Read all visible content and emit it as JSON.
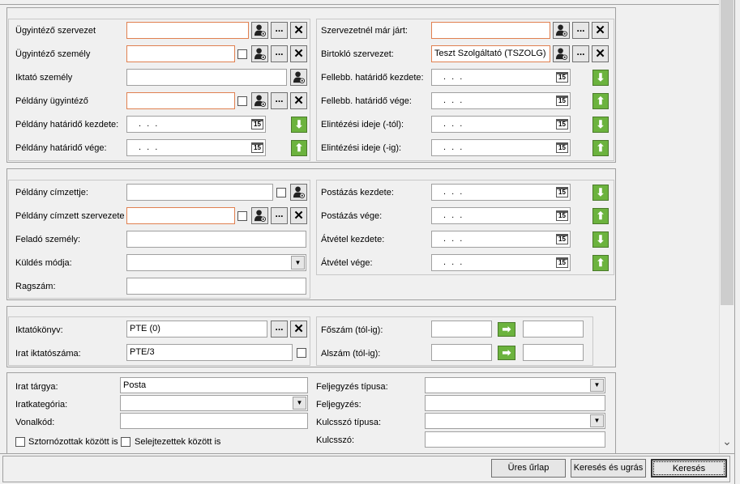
{
  "panel1": {
    "left": {
      "r1": {
        "label": "Ügyintéző szervezet",
        "value": ""
      },
      "r2": {
        "label": "Ügyintéző személy",
        "value": ""
      },
      "r3": {
        "label": "Iktató személy",
        "value": ""
      },
      "r4": {
        "label": "Példány ügyintéző",
        "value": ""
      },
      "r5": {
        "label": "Példány határidő kezdete:",
        "date": ". . ."
      },
      "r6": {
        "label": "Példány határidő vége:",
        "date": ". . ."
      }
    },
    "right": {
      "r1": {
        "label": "Szervezetnél már járt:",
        "value": ""
      },
      "r2": {
        "label": "Birtokló szervezet:",
        "value": "Teszt Szolgáltató (TSZOLG)"
      },
      "r3": {
        "label": "Fellebb. határidő kezdete:",
        "date": ". . ."
      },
      "r4": {
        "label": "Fellebb. határidő vége:",
        "date": ". . ."
      },
      "r5": {
        "label": "Elintézési ideje (-tól):",
        "date": ". . ."
      },
      "r6": {
        "label": "Elintézési ideje (-ig):",
        "date": ". . ."
      }
    }
  },
  "panel2": {
    "left": {
      "r1": {
        "label": "Példány címzettje:",
        "value": ""
      },
      "r2": {
        "label": "Példány címzett szervezete",
        "value": ""
      },
      "r3": {
        "label": "Feladó személy:",
        "value": ""
      },
      "r4": {
        "label": "Küldés módja:",
        "value": ""
      },
      "r5": {
        "label": "Ragszám:",
        "value": ""
      }
    },
    "right": {
      "r1": {
        "label": "Postázás kezdete:",
        "date": ". . ."
      },
      "r2": {
        "label": "Postázás vége:",
        "date": ". . ."
      },
      "r3": {
        "label": "Átvétel kezdete:",
        "date": ". . ."
      },
      "r4": {
        "label": "Átvétel vége:",
        "date": ". . ."
      }
    }
  },
  "panel3": {
    "iktatokonyv": {
      "label": "Iktatókönyv:",
      "value": "PTE (0)"
    },
    "iktatoszam": {
      "label": "Irat iktatószáma:",
      "value": "PTE/3"
    },
    "foszam": {
      "label": "Főszám (tól-ig):",
      "from": "",
      "to": ""
    },
    "alszam": {
      "label": "Alszám (tól-ig):",
      "from": "",
      "to": ""
    }
  },
  "panel4": {
    "targy": {
      "label": "Irat tárgya:",
      "value": "Posta"
    },
    "kategoria": {
      "label": "Iratkategória:",
      "value": ""
    },
    "vonalkod": {
      "label": "Vonalkód:",
      "value": ""
    },
    "sztornozottak": "Sztornózottak között is",
    "selejtezettek": "Selejtezettek között is",
    "feljegyzes_tipusa": {
      "label": "Feljegyzés típusa:",
      "value": ""
    },
    "feljegyzes": {
      "label": "Feljegyzés:",
      "value": ""
    },
    "kulcsszo_tipusa": {
      "label": "Kulcsszó típusa:",
      "value": ""
    },
    "kulcsszo": {
      "label": "Kulcsszó:",
      "value": ""
    }
  },
  "icons": {
    "dots": "...",
    "close": "✕",
    "calendar": "15",
    "arrow_down": "⬇",
    "arrow_up": "⬆",
    "arrow_right": "➡",
    "dropdown": "▼",
    "scroll_down": "⌄"
  },
  "footer": {
    "clear": "Üres űrlap",
    "search_jump": "Keresés és ugrás",
    "search": "Keresés"
  }
}
